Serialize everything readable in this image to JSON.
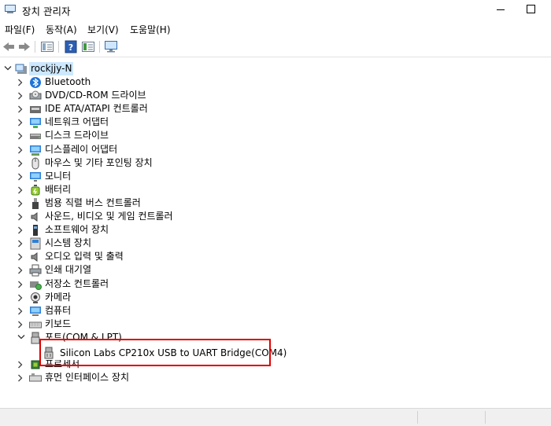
{
  "window": {
    "title": "장치 관리자"
  },
  "menu": [
    "파일(F)",
    "동작(A)",
    "보기(V)",
    "도움말(H)"
  ],
  "toolbar": {
    "buttons": [
      "back-icon",
      "forward-icon",
      "properties-icon",
      "help-icon",
      "view-icon",
      "monitor-icon"
    ]
  },
  "tree": {
    "root": "rockjjy-N",
    "categories": [
      {
        "label": "Bluetooth",
        "icon": "bluetooth-icon"
      },
      {
        "label": "DVD/CD-ROM 드라이브",
        "icon": "dvd-drive-icon"
      },
      {
        "label": "IDE ATA/ATAPI 컨트롤러",
        "icon": "ide-controller-icon"
      },
      {
        "label": "네트워크 어댑터",
        "icon": "network-adapter-icon"
      },
      {
        "label": "디스크 드라이브",
        "icon": "disk-drive-icon"
      },
      {
        "label": "디스플레이 어댑터",
        "icon": "display-adapter-icon"
      },
      {
        "label": "마우스 및 기타 포인팅 장치",
        "icon": "mouse-icon"
      },
      {
        "label": "모니터",
        "icon": "monitor-icon"
      },
      {
        "label": "배터리",
        "icon": "battery-icon"
      },
      {
        "label": "범용 직렬 버스 컨트롤러",
        "icon": "usb-controller-icon"
      },
      {
        "label": "사운드, 비디오 및 게임 컨트롤러",
        "icon": "speaker-icon"
      },
      {
        "label": "소프트웨어 장치",
        "icon": "software-device-icon"
      },
      {
        "label": "시스템 장치",
        "icon": "system-device-icon"
      },
      {
        "label": "오디오 입력 및 출력",
        "icon": "audio-icon"
      },
      {
        "label": "인쇄 대기열",
        "icon": "printer-icon"
      },
      {
        "label": "저장소 컨트롤러",
        "icon": "storage-controller-icon"
      },
      {
        "label": "카메라",
        "icon": "camera-icon"
      },
      {
        "label": "컴퓨터",
        "icon": "computer-icon"
      },
      {
        "label": "키보드",
        "icon": "keyboard-icon"
      },
      {
        "label": "포트(COM & LPT)",
        "icon": "port-icon"
      },
      {
        "label": "프로세서",
        "icon": "processor-icon"
      },
      {
        "label": "휴먼 인터페이스 장치",
        "icon": "hid-icon"
      }
    ],
    "port_child": "Silicon Labs CP210x USB to UART Bridge(COM4)"
  },
  "colors": {
    "selection": "#cce8ff",
    "highlight_box": "#e00000"
  }
}
